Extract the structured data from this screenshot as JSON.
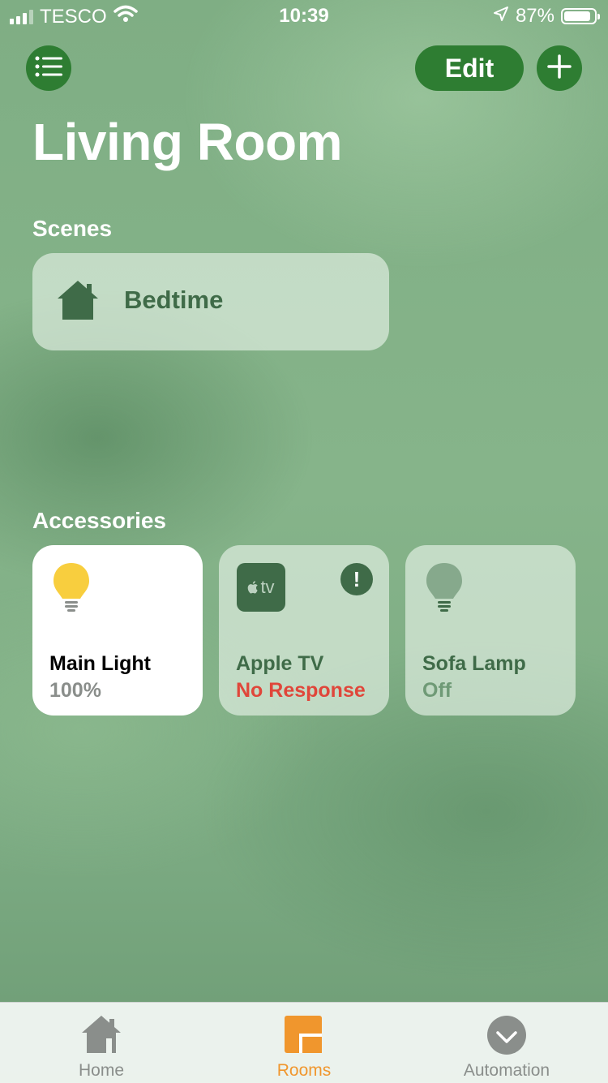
{
  "status_bar": {
    "carrier": "TESCO",
    "time": "10:39",
    "battery": "87%",
    "signal_bars_filled": 3,
    "signal_bars_total": 4
  },
  "header": {
    "edit_label": "Edit",
    "menu_icon": "list-icon",
    "add_icon": "plus-icon"
  },
  "page": {
    "title": "Living Room"
  },
  "scenes": {
    "label": "Scenes",
    "items": [
      {
        "label": "Bedtime",
        "icon": "house-icon"
      }
    ]
  },
  "accessories": {
    "label": "Accessories",
    "items": [
      {
        "name": "Main Light",
        "status": "100%",
        "icon": "lightbulb-icon",
        "state": "on"
      },
      {
        "name": "Apple TV",
        "status": "No Response",
        "icon": "apple-tv-icon",
        "state": "error",
        "badge": "!",
        "tv_text": "tv"
      },
      {
        "name": "Sofa Lamp",
        "status": "Off",
        "icon": "lightbulb-icon",
        "state": "off"
      }
    ]
  },
  "tab_bar": {
    "tabs": [
      {
        "label": "Home",
        "icon": "home-icon",
        "active": false
      },
      {
        "label": "Rooms",
        "icon": "rooms-icon",
        "active": true
      },
      {
        "label": "Automation",
        "icon": "automation-icon",
        "active": false
      }
    ]
  },
  "colors": {
    "accent_green": "#2e7d32",
    "tile_text_green": "#3f6b48",
    "error_red": "#e0463a",
    "bulb_on": "#f8ce3e",
    "active_tab": "#f0962d"
  }
}
